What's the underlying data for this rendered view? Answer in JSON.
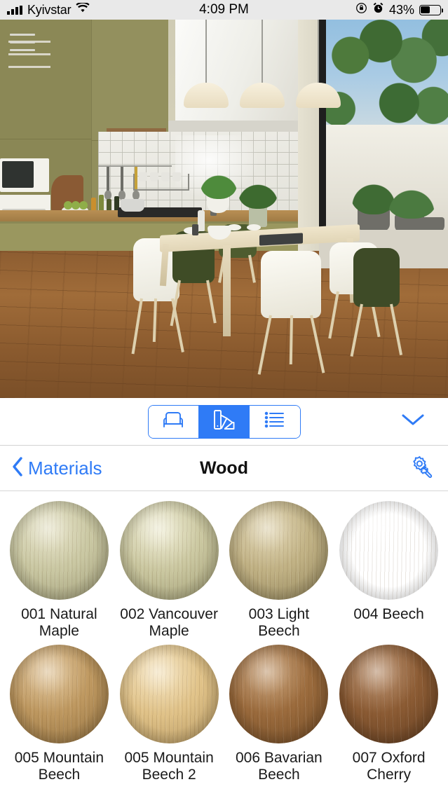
{
  "status_bar": {
    "carrier": "Kyivstar",
    "wifi_icon": "wifi-icon",
    "time": "4:09 PM",
    "rotation_lock_icon": "rotation-lock-icon",
    "alarm_icon": "alarm-clock-icon",
    "battery_percent": "43%",
    "battery_level": 43
  },
  "viewport": {
    "menu_icon": "hamburger-menu-icon",
    "scene_description": "3D rendered kitchen and dining room interior"
  },
  "toolbar": {
    "segments": [
      {
        "name": "furniture",
        "icon": "armchair-icon",
        "active": false
      },
      {
        "name": "materials",
        "icon": "color-swatches-icon",
        "active": true
      },
      {
        "name": "list",
        "icon": "list-icon",
        "active": false
      }
    ],
    "collapse_icon": "chevron-down-icon",
    "accent_color": "#2f7bf6"
  },
  "navbar": {
    "back_icon": "chevron-left-icon",
    "back_label": "Materials",
    "title": "Wood",
    "settings_icon": "gear-wrench-icon"
  },
  "materials": [
    {
      "name": "001 Natural Maple",
      "base": "#c9c7a2",
      "light": "#ddd9b6",
      "dark": "#9b9874"
    },
    {
      "name": "002 Vancouver Maple",
      "base": "#cac7a0",
      "light": "#e8e5c4",
      "dark": "#9d9a72"
    },
    {
      "name": "003 Light Beech",
      "base": "#c0b184",
      "light": "#d6c79a",
      "dark": "#8f8259"
    },
    {
      "name": "004 Beech",
      "base": "#b28b5e",
      "light": "#caa madeup",
      "dark": "#8a6740"
    },
    {
      "name": "005 Mountain Beech",
      "base": "#bd975f",
      "light": "#d6b27a",
      "dark": "#8e6e3f"
    },
    {
      "name": "005 Mountain Beech 2",
      "base": "#e0c288",
      "light": "#f0d9a8",
      "dark": "#b1945f"
    },
    {
      "name": "006 Bavarian Beech",
      "base": "#9a6a3c",
      "light": "#b5834f",
      "dark": "#6f4a26"
    },
    {
      "name": "007 Oxford Cherry",
      "base": "#8a5a33",
      "light": "#a57044",
      "dark": "#5f3c20"
    }
  ]
}
